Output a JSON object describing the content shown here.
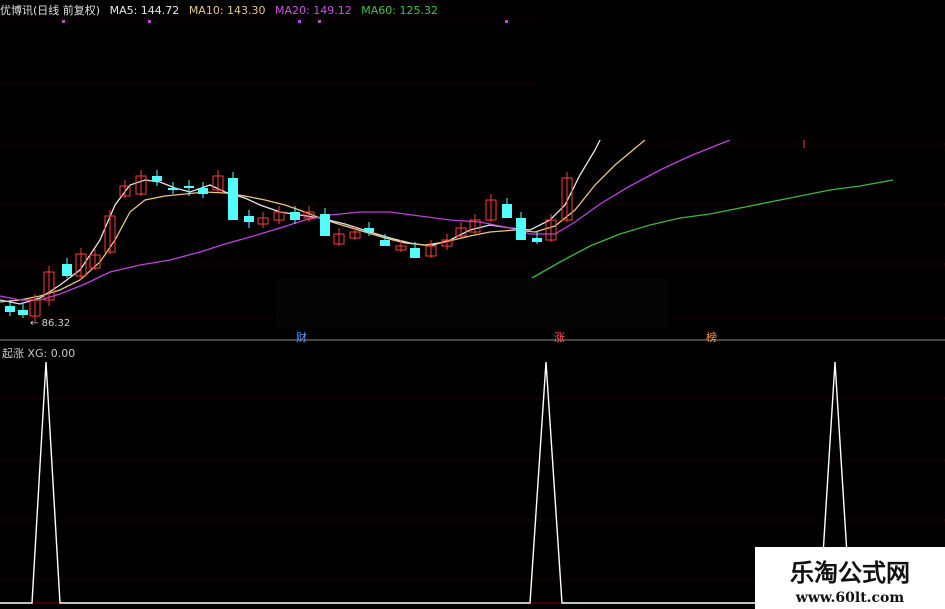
{
  "header": {
    "title": "优博讯(日线 前复权)",
    "ma5_label": "MA5: 144.72",
    "ma10_label": "MA10: 143.30",
    "ma20_label": "MA20: 149.12",
    "ma60_label": "MA60: 125.32"
  },
  "indicator": {
    "label": "起涨 XG: 0.00"
  },
  "annotations": {
    "low_price": "86.32",
    "events": [
      "财",
      "涨",
      "榜"
    ]
  },
  "watermark": {
    "title": "乐淘公式网",
    "url": "www.60lt.com"
  },
  "colors": {
    "background": "#000000",
    "up": "#ff3c3c",
    "down": "#54fcfc",
    "ma5": "#e6e6e6",
    "ma10": "#e8c67a",
    "ma20": "#c040e0",
    "ma60": "#3cb83c",
    "signal": "#ffffff",
    "grid": "#5a0000",
    "event_blue": "#5a9cff",
    "event_red": "#ff5a5a",
    "event_orange": "#ff9a3c"
  }
}
